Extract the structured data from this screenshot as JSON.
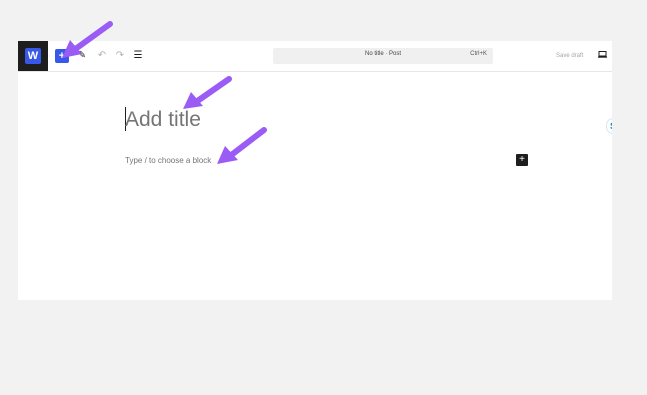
{
  "app": {
    "logo_letter": "W"
  },
  "toolbar": {
    "inserter_symbol": "+",
    "tools": [
      {
        "name": "tools-icon",
        "symbol": "✎"
      },
      {
        "name": "undo-icon",
        "symbol": "↶"
      },
      {
        "name": "redo-icon",
        "symbol": "↷"
      },
      {
        "name": "document-overview-icon",
        "symbol": "☰"
      }
    ],
    "command_bar": {
      "label": "No title · Post",
      "shortcut": "Ctrl+K"
    },
    "save_label": "Save draft"
  },
  "editor": {
    "title_placeholder": "Add title",
    "block_placeholder": "Type / to choose a block",
    "add_block_symbol": "+"
  },
  "badge": {
    "text": "S"
  },
  "colors": {
    "accent": "#3858e9",
    "annotation_arrow": "#9b5cf6",
    "dark": "#1e1e1e",
    "page_bg": "#f2f2f2"
  }
}
